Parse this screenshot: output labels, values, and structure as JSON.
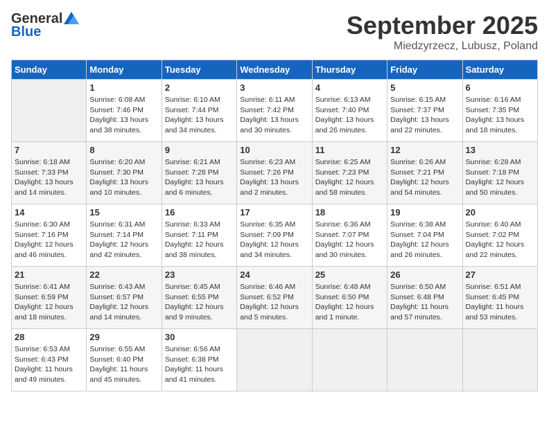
{
  "header": {
    "logo_general": "General",
    "logo_blue": "Blue",
    "month_title": "September 2025",
    "location": "Miedzyrzecz, Lubusz, Poland"
  },
  "columns": [
    "Sunday",
    "Monday",
    "Tuesday",
    "Wednesday",
    "Thursday",
    "Friday",
    "Saturday"
  ],
  "weeks": [
    [
      {
        "day": "",
        "info": ""
      },
      {
        "day": "1",
        "info": "Sunrise: 6:08 AM\nSunset: 7:46 PM\nDaylight: 13 hours\nand 38 minutes."
      },
      {
        "day": "2",
        "info": "Sunrise: 6:10 AM\nSunset: 7:44 PM\nDaylight: 13 hours\nand 34 minutes."
      },
      {
        "day": "3",
        "info": "Sunrise: 6:11 AM\nSunset: 7:42 PM\nDaylight: 13 hours\nand 30 minutes."
      },
      {
        "day": "4",
        "info": "Sunrise: 6:13 AM\nSunset: 7:40 PM\nDaylight: 13 hours\nand 26 minutes."
      },
      {
        "day": "5",
        "info": "Sunrise: 6:15 AM\nSunset: 7:37 PM\nDaylight: 13 hours\nand 22 minutes."
      },
      {
        "day": "6",
        "info": "Sunrise: 6:16 AM\nSunset: 7:35 PM\nDaylight: 13 hours\nand 18 minutes."
      }
    ],
    [
      {
        "day": "7",
        "info": "Sunrise: 6:18 AM\nSunset: 7:33 PM\nDaylight: 13 hours\nand 14 minutes."
      },
      {
        "day": "8",
        "info": "Sunrise: 6:20 AM\nSunset: 7:30 PM\nDaylight: 13 hours\nand 10 minutes."
      },
      {
        "day": "9",
        "info": "Sunrise: 6:21 AM\nSunset: 7:28 PM\nDaylight: 13 hours\nand 6 minutes."
      },
      {
        "day": "10",
        "info": "Sunrise: 6:23 AM\nSunset: 7:26 PM\nDaylight: 13 hours\nand 2 minutes."
      },
      {
        "day": "11",
        "info": "Sunrise: 6:25 AM\nSunset: 7:23 PM\nDaylight: 12 hours\nand 58 minutes."
      },
      {
        "day": "12",
        "info": "Sunrise: 6:26 AM\nSunset: 7:21 PM\nDaylight: 12 hours\nand 54 minutes."
      },
      {
        "day": "13",
        "info": "Sunrise: 6:28 AM\nSunset: 7:18 PM\nDaylight: 12 hours\nand 50 minutes."
      }
    ],
    [
      {
        "day": "14",
        "info": "Sunrise: 6:30 AM\nSunset: 7:16 PM\nDaylight: 12 hours\nand 46 minutes."
      },
      {
        "day": "15",
        "info": "Sunrise: 6:31 AM\nSunset: 7:14 PM\nDaylight: 12 hours\nand 42 minutes."
      },
      {
        "day": "16",
        "info": "Sunrise: 6:33 AM\nSunset: 7:11 PM\nDaylight: 12 hours\nand 38 minutes."
      },
      {
        "day": "17",
        "info": "Sunrise: 6:35 AM\nSunset: 7:09 PM\nDaylight: 12 hours\nand 34 minutes."
      },
      {
        "day": "18",
        "info": "Sunrise: 6:36 AM\nSunset: 7:07 PM\nDaylight: 12 hours\nand 30 minutes."
      },
      {
        "day": "19",
        "info": "Sunrise: 6:38 AM\nSunset: 7:04 PM\nDaylight: 12 hours\nand 26 minutes."
      },
      {
        "day": "20",
        "info": "Sunrise: 6:40 AM\nSunset: 7:02 PM\nDaylight: 12 hours\nand 22 minutes."
      }
    ],
    [
      {
        "day": "21",
        "info": "Sunrise: 6:41 AM\nSunset: 6:59 PM\nDaylight: 12 hours\nand 18 minutes."
      },
      {
        "day": "22",
        "info": "Sunrise: 6:43 AM\nSunset: 6:57 PM\nDaylight: 12 hours\nand 14 minutes."
      },
      {
        "day": "23",
        "info": "Sunrise: 6:45 AM\nSunset: 6:55 PM\nDaylight: 12 hours\nand 9 minutes."
      },
      {
        "day": "24",
        "info": "Sunrise: 6:46 AM\nSunset: 6:52 PM\nDaylight: 12 hours\nand 5 minutes."
      },
      {
        "day": "25",
        "info": "Sunrise: 6:48 AM\nSunset: 6:50 PM\nDaylight: 12 hours\nand 1 minute."
      },
      {
        "day": "26",
        "info": "Sunrise: 6:50 AM\nSunset: 6:48 PM\nDaylight: 11 hours\nand 57 minutes."
      },
      {
        "day": "27",
        "info": "Sunrise: 6:51 AM\nSunset: 6:45 PM\nDaylight: 11 hours\nand 53 minutes."
      }
    ],
    [
      {
        "day": "28",
        "info": "Sunrise: 6:53 AM\nSunset: 6:43 PM\nDaylight: 11 hours\nand 49 minutes."
      },
      {
        "day": "29",
        "info": "Sunrise: 6:55 AM\nSunset: 6:40 PM\nDaylight: 11 hours\nand 45 minutes."
      },
      {
        "day": "30",
        "info": "Sunrise: 6:56 AM\nSunset: 6:38 PM\nDaylight: 11 hours\nand 41 minutes."
      },
      {
        "day": "",
        "info": ""
      },
      {
        "day": "",
        "info": ""
      },
      {
        "day": "",
        "info": ""
      },
      {
        "day": "",
        "info": ""
      }
    ]
  ]
}
